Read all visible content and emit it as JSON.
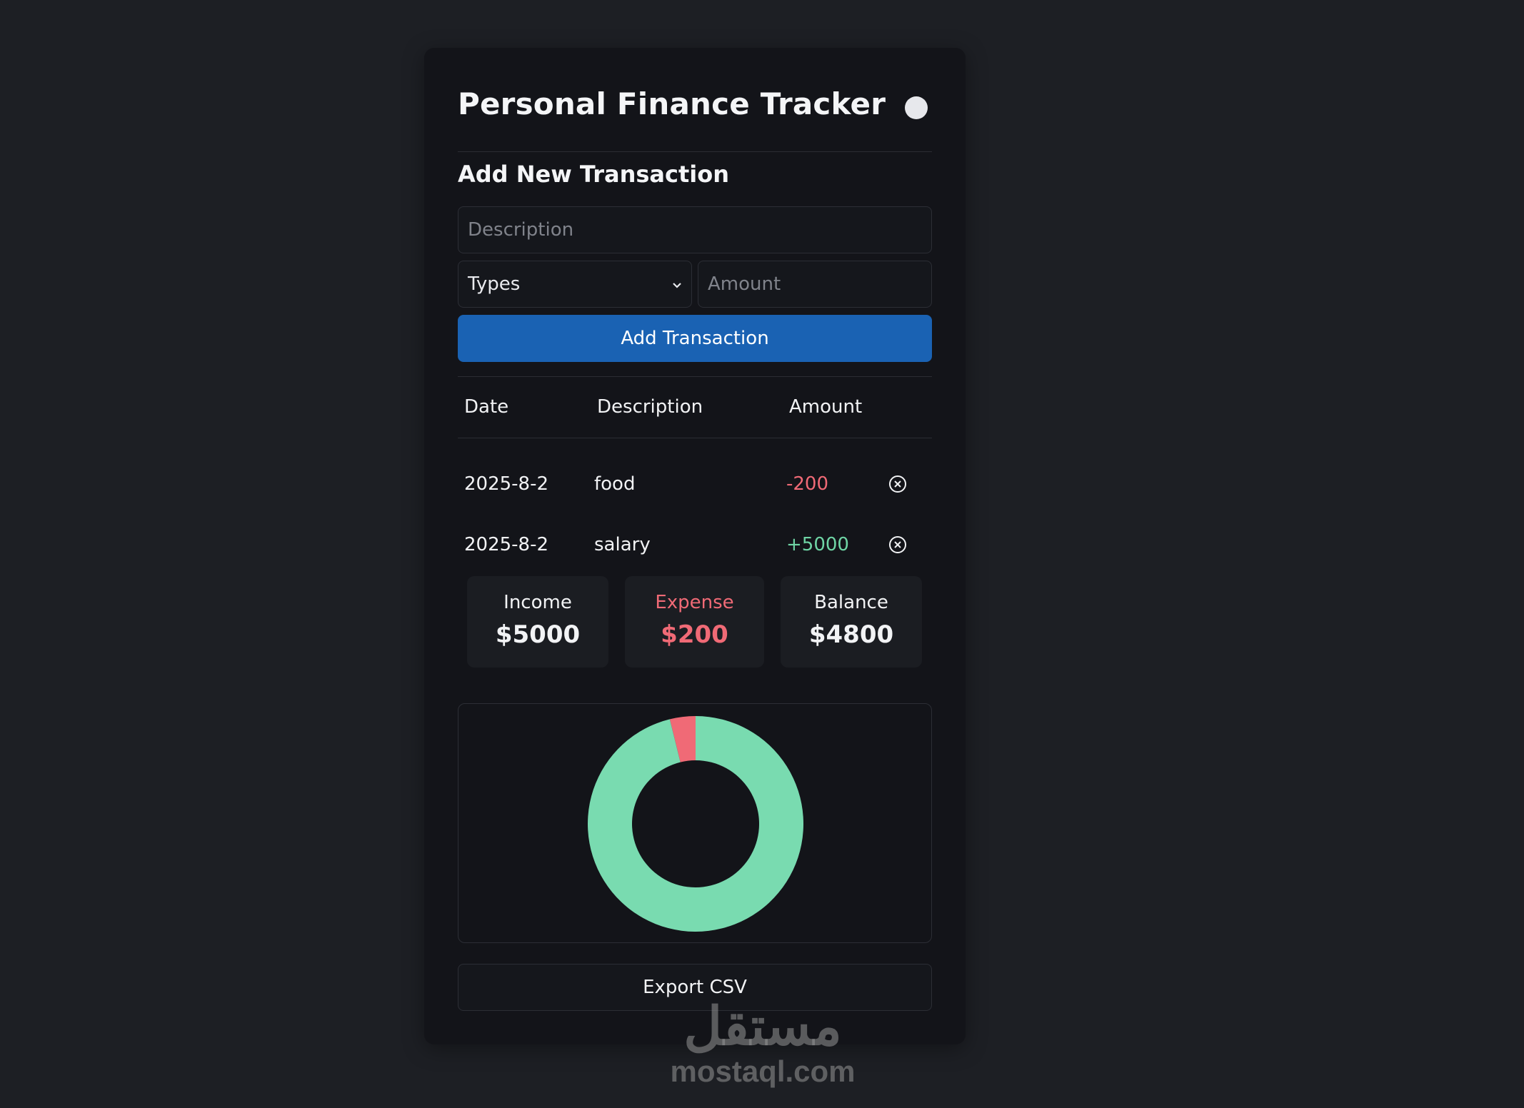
{
  "app": {
    "title": "Personal Finance Tracker"
  },
  "form": {
    "section_title": "Add New Transaction",
    "description_placeholder": "Description",
    "description_value": "",
    "types_selected": "Types",
    "amount_placeholder": "Amount",
    "amount_value": "",
    "add_label": "Add Transaction"
  },
  "table": {
    "headers": [
      "Date",
      "Description",
      "Amount"
    ],
    "rows": [
      {
        "date": "2025-8-2",
        "description": "food",
        "amount": "-200",
        "kind": "expense"
      },
      {
        "date": "2025-8-2",
        "description": "salary",
        "amount": "+5000",
        "kind": "income"
      }
    ]
  },
  "summary": {
    "income_label": "Income",
    "income_value": "$5000",
    "expense_label": "Expense",
    "expense_value": "$200",
    "balance_label": "Balance",
    "balance_value": "$4800"
  },
  "colors": {
    "accent": "#1a62b3",
    "income": "#79dbb0",
    "expense": "#f06a76",
    "background": "#1d1f24",
    "card": "#131419"
  },
  "chart_data": {
    "type": "pie",
    "donut": true,
    "slices": [
      {
        "label": "Expense",
        "value": 200,
        "color": "#f06a76"
      },
      {
        "label": "Income",
        "value": 5000,
        "color": "#79dbb0"
      }
    ]
  },
  "icons": {
    "delete": "circle-x-icon",
    "toggle": "theme-toggle-dot"
  },
  "export": {
    "label": "Export CSV"
  },
  "watermark": {
    "arabic": "مستقل",
    "latin": "mostaql.com"
  }
}
